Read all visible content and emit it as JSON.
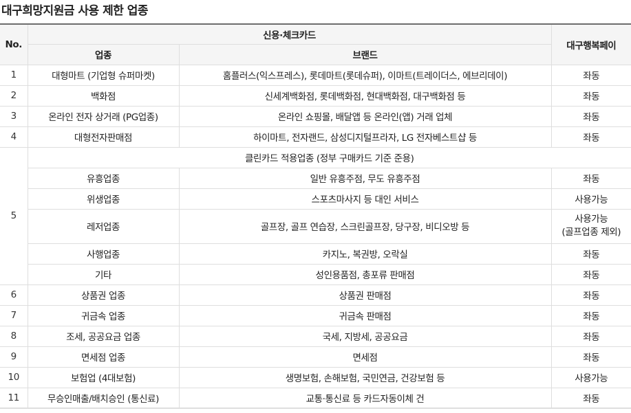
{
  "title": "대구희망지원금 사용 제한 업종",
  "header": {
    "no": "No.",
    "card_group": "신용·체크카드",
    "category": "업종",
    "brand": "브랜드",
    "pay": "대구행복페이"
  },
  "rows": [
    {
      "no": "1",
      "category": "대형마트 (기업형 슈퍼마켓)",
      "brand": "홈플러스(익스프레스), 롯데마트(롯데슈퍼), 이마트(트레이더스, 에브리데이)",
      "pay": "좌동"
    },
    {
      "no": "2",
      "category": "백화점",
      "brand": "신세계백화점, 롯데백화점, 현대백화점, 대구백화점 등",
      "pay": "좌동"
    },
    {
      "no": "3",
      "category": "온라인 전자 상거래 (PG업종)",
      "brand": "온라인 쇼핑몰, 배달앱 등 온라인(앱) 거래 업체",
      "pay": "좌동"
    },
    {
      "no": "4",
      "category": "대형전자판매점",
      "brand": "하이마트, 전자랜드, 삼성디지털프라자, LG 전자베스트샵 등",
      "pay": "좌동"
    }
  ],
  "group5": {
    "no": "5",
    "note": "클린카드 적용업종 (정부 구매카드 기준 준용)",
    "rows": [
      {
        "category": "유흥업종",
        "brand": "일반 유흥주점, 무도 유흥주점",
        "pay": "좌동"
      },
      {
        "category": "위생업종",
        "brand": "스포츠마사지 등 대인 서비스",
        "pay": "사용가능"
      },
      {
        "category": "레저업종",
        "brand": "골프장, 골프 연습장, 스크린골프장, 당구장, 비디오방 등",
        "pay": "사용가능",
        "pay_note": "(골프업종 제외)"
      },
      {
        "category": "사행업종",
        "brand": "카지노, 복권방, 오락실",
        "pay": "좌동"
      },
      {
        "category": "기타",
        "brand": "성인용품점, 총포류 판매점",
        "pay": "좌동"
      }
    ]
  },
  "rows_after": [
    {
      "no": "6",
      "category": "상품권 업종",
      "brand": "상품권 판매점",
      "pay": "좌동"
    },
    {
      "no": "7",
      "category": "귀금속 업종",
      "brand": "귀금속 판매점",
      "pay": "좌동"
    },
    {
      "no": "8",
      "category": "조세, 공공요금 업종",
      "brand": "국세, 지방세, 공공요금",
      "pay": "좌동"
    },
    {
      "no": "9",
      "category": "면세점 업종",
      "brand": "면세점",
      "pay": "좌동"
    },
    {
      "no": "10",
      "category": "보험업 (4대보험)",
      "brand": "생명보험, 손해보험, 국민연금, 건강보험 등",
      "pay": "사용가능"
    },
    {
      "no": "11",
      "category": "무승인매출/배치승인 (통신료)",
      "brand": "교통·통신료 등 카드자동이체 건",
      "pay": "좌동"
    }
  ]
}
